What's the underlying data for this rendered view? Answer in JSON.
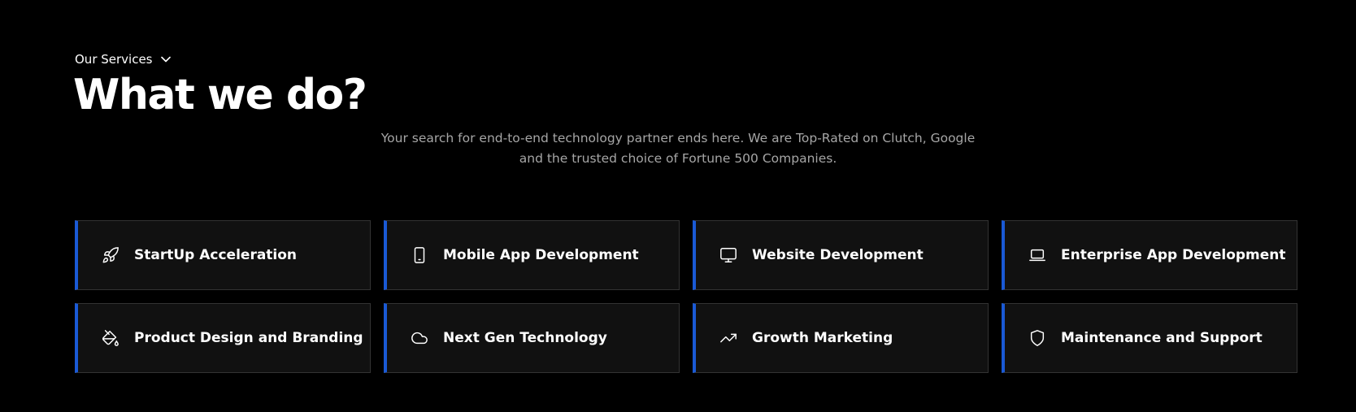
{
  "header": {
    "eyebrow_label": "Our Services",
    "title": "What we do?",
    "description_line1": "Your search for end-to-end technology partner ends here. We are Top-Rated on Clutch, Google",
    "description_line2": "and the trusted choice of Fortune 500 Companies."
  },
  "colors": {
    "background": "#000000",
    "card_background": "#111111",
    "card_border": "#333333",
    "accent": "#1a5ad6",
    "description_text": "#a6a6a6"
  },
  "services": [
    {
      "label": "StartUp Acceleration",
      "icon": "rocket-icon"
    },
    {
      "label": "Mobile App Development",
      "icon": "smartphone-icon"
    },
    {
      "label": "Website Development",
      "icon": "monitor-icon"
    },
    {
      "label": "Enterprise App Development",
      "icon": "laptop-icon"
    },
    {
      "label": "Product Design and Branding",
      "icon": "paint-bucket-icon"
    },
    {
      "label": "Next Gen Technology",
      "icon": "cloud-icon"
    },
    {
      "label": "Growth Marketing",
      "icon": "trending-up-icon"
    },
    {
      "label": "Maintenance and Support",
      "icon": "shield-icon"
    }
  ]
}
